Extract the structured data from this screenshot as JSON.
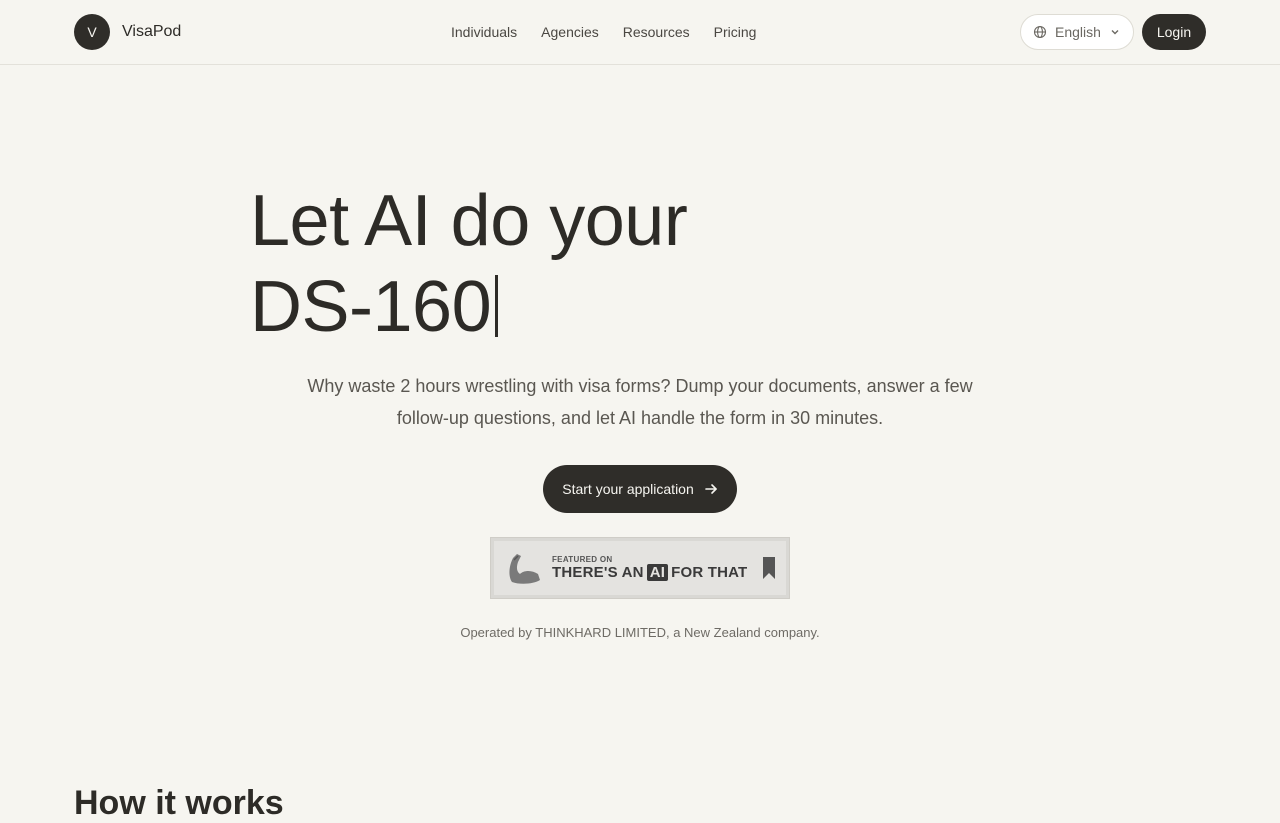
{
  "brand": {
    "avatar_letter": "V",
    "name": "VisaPod"
  },
  "nav": {
    "items": [
      {
        "label": "Individuals"
      },
      {
        "label": "Agencies"
      },
      {
        "label": "Resources"
      },
      {
        "label": "Pricing"
      }
    ]
  },
  "language": {
    "selected": "English",
    "icon": "globe-icon"
  },
  "login_label": "Login",
  "hero": {
    "title_line1": "Let AI do your",
    "title_line2": "DS-160",
    "subtitle": "Why waste 2 hours wrestling with visa forms? Dump your documents, answer a few follow-up questions, and let AI handle the form in 30 minutes.",
    "cta_label": "Start your application"
  },
  "badge": {
    "small_text": "FEATURED ON",
    "big_text_before": "THERE'S AN",
    "big_text_ai": "AI",
    "big_text_after": "FOR THAT"
  },
  "operator_text": "Operated by THINKHARD LIMITED, a New Zealand company.",
  "next_section_heading": "How it works",
  "colors": {
    "background": "#f6f5f0",
    "primary_dark": "#2f2d29",
    "text": "#2d2b27",
    "muted_text": "#5a5751"
  }
}
